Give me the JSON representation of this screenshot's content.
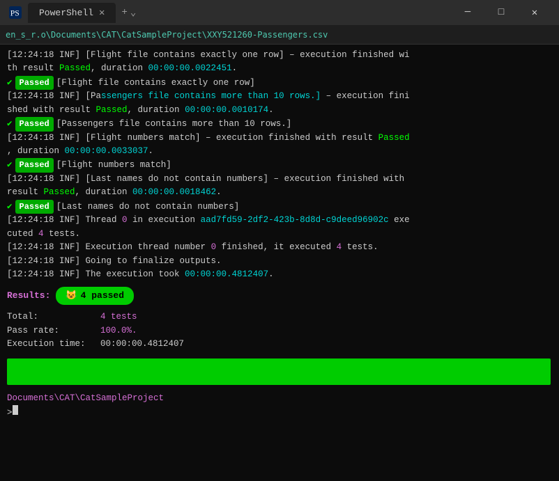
{
  "titlebar": {
    "icon": "powershell-icon",
    "tab_label": "PowerShell",
    "close_label": "✕",
    "minimize_label": "─",
    "maximize_label": "□",
    "plus_label": "+",
    "chevron_label": "⌄"
  },
  "address": {
    "path": "en_s_r.o\\Documents\\CAT\\CatSampleProject\\XXY521260-Passengers.csv"
  },
  "terminal": {
    "lines": [
      {
        "type": "log",
        "time": "12:24:18",
        "level": "INF",
        "msg_before": "[Flight file contains exactly one row] – execution fini",
        "msg_after": "shed with result",
        "result": "Passed",
        "duration_label": ", duration",
        "duration": "00:00:00.0022451",
        "end": "."
      },
      {
        "type": "passed",
        "check": "✔",
        "badge": "Passed",
        "msg": "[Flight file contains exactly one row]"
      },
      {
        "type": "log",
        "time": "12:24:18",
        "level": "INF",
        "msg_before": "[Passengers file contains more than 10 rows.] – execution fini",
        "msg_after": "shed with result",
        "result": "Passed",
        "duration_label": ", duration",
        "duration": "00:00:00.0010174",
        "end": "."
      },
      {
        "type": "passed",
        "check": "✔",
        "badge": "Passed",
        "msg": "[Passengers file contains more than 10 rows.]"
      },
      {
        "type": "log_multiline",
        "time": "12:24:18",
        "level": "INF",
        "msg": "[Flight numbers match] – execution finished with result",
        "result": "Passed",
        "duration": "00:00:00.0033037",
        "end": "."
      },
      {
        "type": "passed",
        "check": "✔",
        "badge": "Passed",
        "msg": "[Flight numbers match]"
      },
      {
        "type": "log_multiline",
        "time": "12:24:18",
        "level": "INF",
        "msg": "[Last names do not contain numbers] – execution finished with result",
        "result": "Passed",
        "duration": "00:00:00.0018462",
        "end": "."
      },
      {
        "type": "passed",
        "check": "✔",
        "badge": "Passed",
        "msg": "[Last names do not contain numbers]"
      },
      {
        "type": "log",
        "time": "12:24:18",
        "level": "INF",
        "thread_msg": "Thread",
        "thread_num": "0",
        "in_exec": "in execution",
        "exec_id": "aad7fd59-2df2-423b-8d8d-c9deed96902c",
        "exe_msg": "executed",
        "count": "4",
        "tests": "tests."
      },
      {
        "type": "log_simple",
        "time": "12:24:18",
        "level": "INF",
        "msg_before": "Execution thread number",
        "highlight": "0",
        "msg_mid": "finished, it executed",
        "count": "4",
        "msg_end": "tests."
      },
      {
        "type": "log_plain",
        "time": "12:24:18",
        "level": "INF",
        "msg": "Going to finalize outputs."
      },
      {
        "type": "log_plain",
        "time": "12:24:18",
        "level": "INF",
        "msg_before": "The execution took",
        "duration": "00:00:00.4812407",
        "end": "."
      }
    ],
    "results": {
      "label": "Results:",
      "badge_emoji": "😺",
      "badge_text": "4 passed"
    },
    "stats": {
      "total_label": "Total:",
      "total_value": "4 tests",
      "passrate_label": "Pass rate:",
      "passrate_value": "100.0%.",
      "exectime_label": "Execution time:",
      "exectime_value": "00:00:00.4812407"
    },
    "prompt": {
      "path": "Documents\\CAT\\CatSampleProject",
      "ps": "> ",
      "cursor": ""
    }
  }
}
